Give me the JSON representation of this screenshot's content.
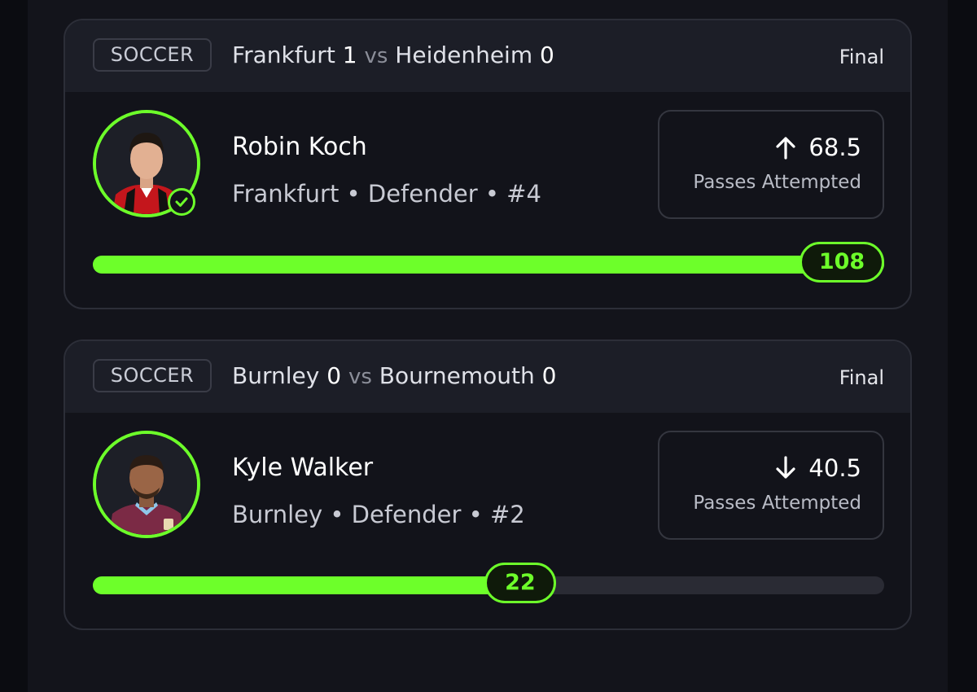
{
  "colors": {
    "accent": "#6dff2a",
    "background": "#0b0c11",
    "card": "#12131a",
    "card_header": "#1c1e27",
    "track": "#2a2b34"
  },
  "cards": [
    {
      "sport": "SOCCER",
      "team_a": "Frankfurt",
      "score_a": "1",
      "vs": "vs",
      "team_b": "Heidenheim",
      "score_b": "0",
      "status": "Final",
      "player": {
        "name": "Robin Koch",
        "meta": "Frankfurt • Defender • #4",
        "avatar_icon": "player-photo",
        "verified_icon": "check-circle-icon"
      },
      "line": {
        "direction_icon": "arrow-up-icon",
        "value": "68.5",
        "stat": "Passes Attempted"
      },
      "progress": {
        "result": "108",
        "fill_fraction": 1.0
      }
    },
    {
      "sport": "SOCCER",
      "team_a": "Burnley",
      "score_a": "0",
      "vs": "vs",
      "team_b": "Bournemouth",
      "score_b": "0",
      "status": "Final",
      "player": {
        "name": "Kyle Walker",
        "meta": "Burnley • Defender • #2",
        "avatar_icon": "player-photo"
      },
      "line": {
        "direction_icon": "arrow-down-icon",
        "value": "40.5",
        "stat": "Passes Attempted"
      },
      "progress": {
        "result": "22",
        "fill_fraction": 0.54
      }
    }
  ]
}
